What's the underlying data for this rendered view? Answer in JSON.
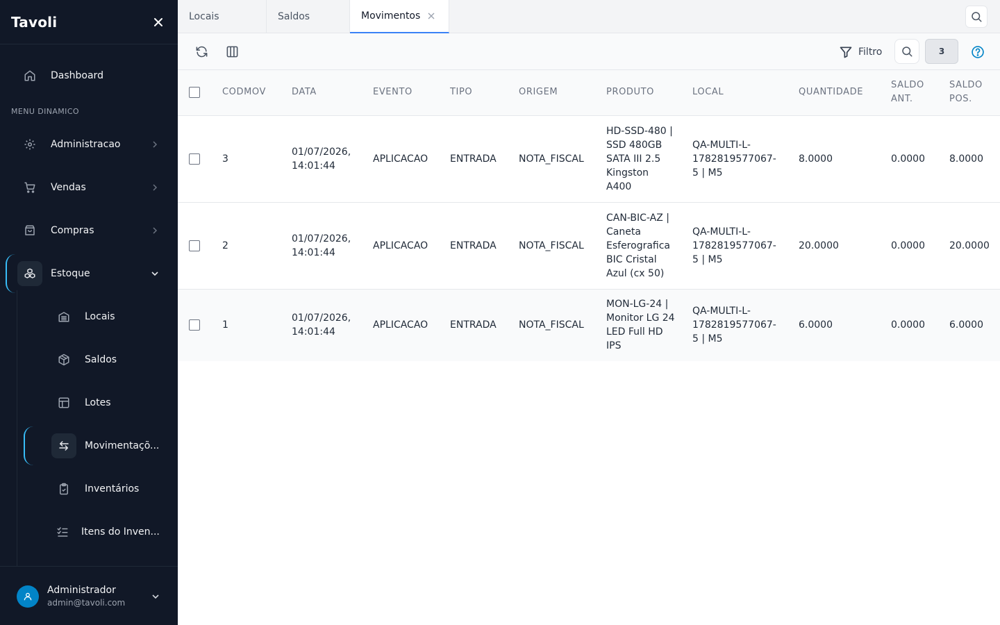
{
  "app": {
    "name": "Tavoli"
  },
  "sidebar": {
    "dashboard": "Dashboard",
    "section_title": "MENU DINAMICO",
    "items": [
      {
        "label": "Administracao"
      },
      {
        "label": "Vendas"
      },
      {
        "label": "Compras"
      },
      {
        "label": "Estoque"
      }
    ],
    "sub_items": [
      {
        "label": "Locais"
      },
      {
        "label": "Saldos"
      },
      {
        "label": "Lotes"
      },
      {
        "label": "Movimentaçõ..."
      },
      {
        "label": "Inventários"
      },
      {
        "label": "Itens do Inven..."
      }
    ],
    "user": {
      "name": "Administrador",
      "email": "admin@tavoli.com"
    }
  },
  "tabs": [
    {
      "label": "Locais"
    },
    {
      "label": "Saldos"
    },
    {
      "label": "Movimentos"
    }
  ],
  "toolbar": {
    "filter_label": "Filtro",
    "count": "3"
  },
  "table": {
    "headers": [
      "CODMOV",
      "DATA",
      "EVENTO",
      "TIPO",
      "ORIGEM",
      "PRODUTO",
      "LOCAL",
      "QUANTIDADE",
      "SALDO ANT.",
      "SALDO POS."
    ],
    "rows": [
      {
        "codmov": "3",
        "data": "01/07/2026, 14:01:44",
        "evento": "APLICACAO",
        "tipo": "ENTRADA",
        "origem": "NOTA_FISCAL",
        "produto": "HD-SSD-480 | SSD 480GB SATA III 2.5 Kingston A400",
        "local": "QA-MULTI-L-1782819577067-5 | M5",
        "quantidade": "8.0000",
        "saldo_ant": "0.0000",
        "saldo_pos": "8.0000"
      },
      {
        "codmov": "2",
        "data": "01/07/2026, 14:01:44",
        "evento": "APLICACAO",
        "tipo": "ENTRADA",
        "origem": "NOTA_FISCAL",
        "produto": "CAN-BIC-AZ | Caneta Esferografica BIC Cristal Azul (cx 50)",
        "local": "QA-MULTI-L-1782819577067-5 | M5",
        "quantidade": "20.0000",
        "saldo_ant": "0.0000",
        "saldo_pos": "20.0000"
      },
      {
        "codmov": "1",
        "data": "01/07/2026, 14:01:44",
        "evento": "APLICACAO",
        "tipo": "ENTRADA",
        "origem": "NOTA_FISCAL",
        "produto": "MON-LG-24 | Monitor LG 24 LED Full HD IPS",
        "local": "QA-MULTI-L-1782819577067-5 | M5",
        "quantidade": "6.0000",
        "saldo_ant": "0.0000",
        "saldo_pos": "6.0000"
      }
    ]
  },
  "colors": {
    "sidebar_bg": "#111827",
    "accent": "#3b82f6",
    "active_indicator": "#38bdf8",
    "avatar": "#0284c7",
    "help": "#0284c7"
  },
  "icons": {
    "brand_close": "close-icon",
    "dashboard": "home-icon",
    "administracao": "gear-icon",
    "vendas": "cart-icon",
    "compras": "shopping-bag-icon",
    "estoque": "boxes-icon",
    "locais": "building-icon",
    "saldos": "package-icon",
    "lotes": "layout-icon",
    "movimentacoes": "arrows-left-right-icon",
    "inventarios": "clipboard-check-icon",
    "itens_inventario": "list-checks-icon",
    "refresh": "refresh-icon",
    "columns": "columns-icon",
    "filter": "filter-icon",
    "search": "search-icon",
    "help": "help-circle-icon",
    "user": "user-icon"
  }
}
